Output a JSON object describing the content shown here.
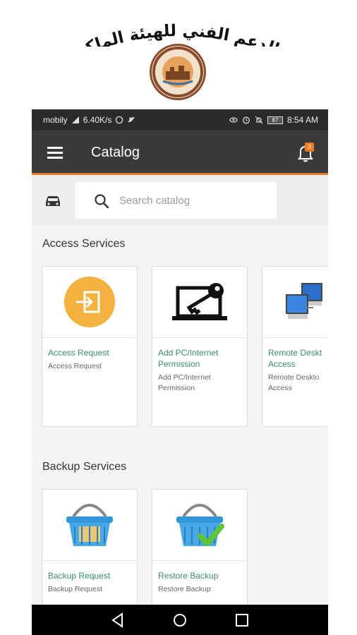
{
  "header_banner": {
    "arabic_title": "تطبيق الدعم الفني للهيئة الملكية بينبع"
  },
  "status_bar": {
    "carrier": "mobily",
    "speed": "6.40K/s",
    "battery": "87",
    "time": "8:54 AM"
  },
  "app_bar": {
    "title": "Catalog",
    "notification_count": "3"
  },
  "search": {
    "placeholder": "Search catalog"
  },
  "sections": [
    {
      "title": "Access Services",
      "items": [
        {
          "title": "Access Request",
          "subtitle": "Access Request",
          "icon": "login-icon"
        },
        {
          "title": "Add PC/Internet\nPermission",
          "subtitle": "Add PC/Internet\nPermission",
          "icon": "laptop-key-icon"
        },
        {
          "title": "Remote Deskt\nAccess",
          "subtitle": "Remote Deskto\nAccess",
          "icon": "network-computers-icon"
        }
      ]
    },
    {
      "title": "Backup Services",
      "items": [
        {
          "title": "Backup Request",
          "subtitle": "Backup Request",
          "icon": "basket-icon"
        },
        {
          "title": "Restore Backup",
          "subtitle": "Restore Backup",
          "icon": "basket-check-icon"
        }
      ]
    }
  ],
  "colors": {
    "accent": "#e8782a",
    "link": "#3a8e6e",
    "app_bar": "#3a3a3a",
    "status_bar": "#2b2b2b"
  }
}
